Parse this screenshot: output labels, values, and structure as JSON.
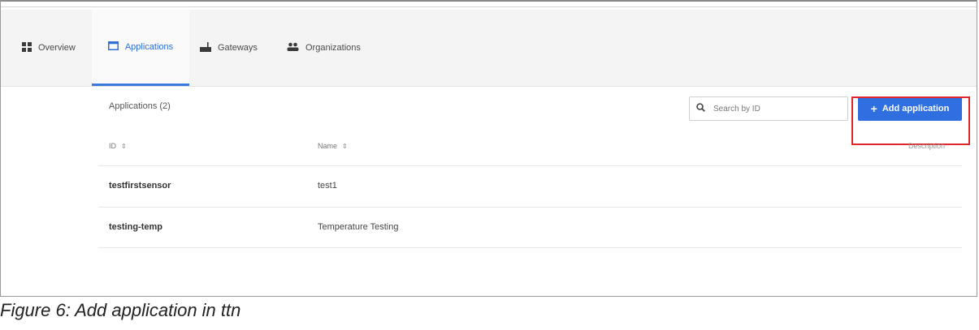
{
  "nav": {
    "items": [
      {
        "label": "Overview",
        "icon": "grid-icon"
      },
      {
        "label": "Applications",
        "icon": "window-icon",
        "active": true
      },
      {
        "label": "Gateways",
        "icon": "gateway-icon"
      },
      {
        "label": "Organizations",
        "icon": "people-icon"
      }
    ]
  },
  "list": {
    "title": "Applications (2)",
    "search_placeholder": "Search by ID",
    "add_button_label": "Add application",
    "add_button_icon": "plus-icon",
    "columns": {
      "id": "ID",
      "name": "Name",
      "description": "Description"
    },
    "rows": [
      {
        "id": "testfirstsensor",
        "name": "test1"
      },
      {
        "id": "testing-temp",
        "name": "Temperature Testing"
      }
    ]
  },
  "caption": "Figure 6: Add application in ttn",
  "colors": {
    "accent": "#2f6fe0",
    "highlight": "#e0262b"
  }
}
